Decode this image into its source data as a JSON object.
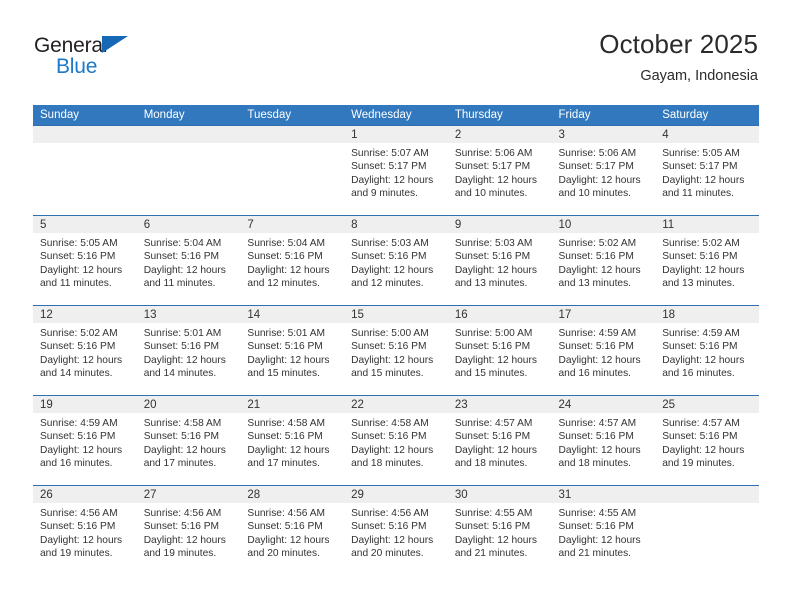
{
  "brand": {
    "name_part1": "General",
    "name_part2": "Blue",
    "triangle_color": "#1667b4",
    "blue_color": "#1c78c8"
  },
  "header": {
    "title": "October 2025",
    "location": "Gayam, Indonesia"
  },
  "theme": {
    "header_bg": "#3178be",
    "row_divider": "#2f6fb0",
    "daynum_band_bg": "#efefef",
    "text": "#333333"
  },
  "weekday_headers": [
    "Sunday",
    "Monday",
    "Tuesday",
    "Wednesday",
    "Thursday",
    "Friday",
    "Saturday"
  ],
  "weeks": [
    [
      {
        "day": "",
        "sunrise": "",
        "sunset": "",
        "daylight": "",
        "empty": true
      },
      {
        "day": "",
        "sunrise": "",
        "sunset": "",
        "daylight": "",
        "empty": true
      },
      {
        "day": "",
        "sunrise": "",
        "sunset": "",
        "daylight": "",
        "empty": true
      },
      {
        "day": "1",
        "sunrise": "Sunrise: 5:07 AM",
        "sunset": "Sunset: 5:17 PM",
        "daylight": "Daylight: 12 hours and 9 minutes.",
        "empty": false
      },
      {
        "day": "2",
        "sunrise": "Sunrise: 5:06 AM",
        "sunset": "Sunset: 5:17 PM",
        "daylight": "Daylight: 12 hours and 10 minutes.",
        "empty": false
      },
      {
        "day": "3",
        "sunrise": "Sunrise: 5:06 AM",
        "sunset": "Sunset: 5:17 PM",
        "daylight": "Daylight: 12 hours and 10 minutes.",
        "empty": false
      },
      {
        "day": "4",
        "sunrise": "Sunrise: 5:05 AM",
        "sunset": "Sunset: 5:17 PM",
        "daylight": "Daylight: 12 hours and 11 minutes.",
        "empty": false
      }
    ],
    [
      {
        "day": "5",
        "sunrise": "Sunrise: 5:05 AM",
        "sunset": "Sunset: 5:16 PM",
        "daylight": "Daylight: 12 hours and 11 minutes.",
        "empty": false
      },
      {
        "day": "6",
        "sunrise": "Sunrise: 5:04 AM",
        "sunset": "Sunset: 5:16 PM",
        "daylight": "Daylight: 12 hours and 11 minutes.",
        "empty": false
      },
      {
        "day": "7",
        "sunrise": "Sunrise: 5:04 AM",
        "sunset": "Sunset: 5:16 PM",
        "daylight": "Daylight: 12 hours and 12 minutes.",
        "empty": false
      },
      {
        "day": "8",
        "sunrise": "Sunrise: 5:03 AM",
        "sunset": "Sunset: 5:16 PM",
        "daylight": "Daylight: 12 hours and 12 minutes.",
        "empty": false
      },
      {
        "day": "9",
        "sunrise": "Sunrise: 5:03 AM",
        "sunset": "Sunset: 5:16 PM",
        "daylight": "Daylight: 12 hours and 13 minutes.",
        "empty": false
      },
      {
        "day": "10",
        "sunrise": "Sunrise: 5:02 AM",
        "sunset": "Sunset: 5:16 PM",
        "daylight": "Daylight: 12 hours and 13 minutes.",
        "empty": false
      },
      {
        "day": "11",
        "sunrise": "Sunrise: 5:02 AM",
        "sunset": "Sunset: 5:16 PM",
        "daylight": "Daylight: 12 hours and 13 minutes.",
        "empty": false
      }
    ],
    [
      {
        "day": "12",
        "sunrise": "Sunrise: 5:02 AM",
        "sunset": "Sunset: 5:16 PM",
        "daylight": "Daylight: 12 hours and 14 minutes.",
        "empty": false
      },
      {
        "day": "13",
        "sunrise": "Sunrise: 5:01 AM",
        "sunset": "Sunset: 5:16 PM",
        "daylight": "Daylight: 12 hours and 14 minutes.",
        "empty": false
      },
      {
        "day": "14",
        "sunrise": "Sunrise: 5:01 AM",
        "sunset": "Sunset: 5:16 PM",
        "daylight": "Daylight: 12 hours and 15 minutes.",
        "empty": false
      },
      {
        "day": "15",
        "sunrise": "Sunrise: 5:00 AM",
        "sunset": "Sunset: 5:16 PM",
        "daylight": "Daylight: 12 hours and 15 minutes.",
        "empty": false
      },
      {
        "day": "16",
        "sunrise": "Sunrise: 5:00 AM",
        "sunset": "Sunset: 5:16 PM",
        "daylight": "Daylight: 12 hours and 15 minutes.",
        "empty": false
      },
      {
        "day": "17",
        "sunrise": "Sunrise: 4:59 AM",
        "sunset": "Sunset: 5:16 PM",
        "daylight": "Daylight: 12 hours and 16 minutes.",
        "empty": false
      },
      {
        "day": "18",
        "sunrise": "Sunrise: 4:59 AM",
        "sunset": "Sunset: 5:16 PM",
        "daylight": "Daylight: 12 hours and 16 minutes.",
        "empty": false
      }
    ],
    [
      {
        "day": "19",
        "sunrise": "Sunrise: 4:59 AM",
        "sunset": "Sunset: 5:16 PM",
        "daylight": "Daylight: 12 hours and 16 minutes.",
        "empty": false
      },
      {
        "day": "20",
        "sunrise": "Sunrise: 4:58 AM",
        "sunset": "Sunset: 5:16 PM",
        "daylight": "Daylight: 12 hours and 17 minutes.",
        "empty": false
      },
      {
        "day": "21",
        "sunrise": "Sunrise: 4:58 AM",
        "sunset": "Sunset: 5:16 PM",
        "daylight": "Daylight: 12 hours and 17 minutes.",
        "empty": false
      },
      {
        "day": "22",
        "sunrise": "Sunrise: 4:58 AM",
        "sunset": "Sunset: 5:16 PM",
        "daylight": "Daylight: 12 hours and 18 minutes.",
        "empty": false
      },
      {
        "day": "23",
        "sunrise": "Sunrise: 4:57 AM",
        "sunset": "Sunset: 5:16 PM",
        "daylight": "Daylight: 12 hours and 18 minutes.",
        "empty": false
      },
      {
        "day": "24",
        "sunrise": "Sunrise: 4:57 AM",
        "sunset": "Sunset: 5:16 PM",
        "daylight": "Daylight: 12 hours and 18 minutes.",
        "empty": false
      },
      {
        "day": "25",
        "sunrise": "Sunrise: 4:57 AM",
        "sunset": "Sunset: 5:16 PM",
        "daylight": "Daylight: 12 hours and 19 minutes.",
        "empty": false
      }
    ],
    [
      {
        "day": "26",
        "sunrise": "Sunrise: 4:56 AM",
        "sunset": "Sunset: 5:16 PM",
        "daylight": "Daylight: 12 hours and 19 minutes.",
        "empty": false
      },
      {
        "day": "27",
        "sunrise": "Sunrise: 4:56 AM",
        "sunset": "Sunset: 5:16 PM",
        "daylight": "Daylight: 12 hours and 19 minutes.",
        "empty": false
      },
      {
        "day": "28",
        "sunrise": "Sunrise: 4:56 AM",
        "sunset": "Sunset: 5:16 PM",
        "daylight": "Daylight: 12 hours and 20 minutes.",
        "empty": false
      },
      {
        "day": "29",
        "sunrise": "Sunrise: 4:56 AM",
        "sunset": "Sunset: 5:16 PM",
        "daylight": "Daylight: 12 hours and 20 minutes.",
        "empty": false
      },
      {
        "day": "30",
        "sunrise": "Sunrise: 4:55 AM",
        "sunset": "Sunset: 5:16 PM",
        "daylight": "Daylight: 12 hours and 21 minutes.",
        "empty": false
      },
      {
        "day": "31",
        "sunrise": "Sunrise: 4:55 AM",
        "sunset": "Sunset: 5:16 PM",
        "daylight": "Daylight: 12 hours and 21 minutes.",
        "empty": false
      },
      {
        "day": "",
        "sunrise": "",
        "sunset": "",
        "daylight": "",
        "empty": true
      }
    ]
  ]
}
